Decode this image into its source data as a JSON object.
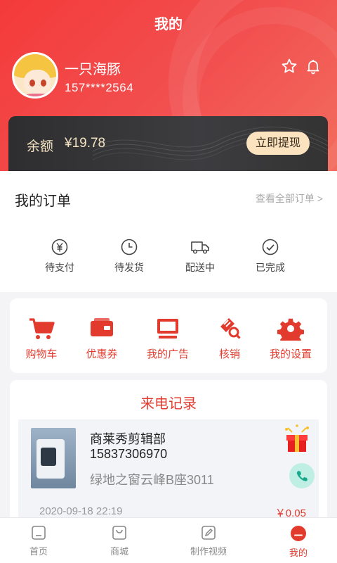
{
  "header": {
    "title": "我的"
  },
  "user": {
    "name": "一只海豚",
    "phone": "157****2564"
  },
  "actions": {
    "favorite_icon": "star-outline-icon",
    "notify_icon": "bell-icon"
  },
  "balance": {
    "label": "余额",
    "value": "¥19.78",
    "withdraw_label": "立即提现"
  },
  "orders": {
    "title": "我的订单",
    "view_all": "查看全部订单 >",
    "items": [
      {
        "label": "待支付",
        "icon": "yen-circle-icon"
      },
      {
        "label": "待发货",
        "icon": "clock-icon"
      },
      {
        "label": "配送中",
        "icon": "delivery-truck-icon"
      },
      {
        "label": "已完成",
        "icon": "check-circle-icon"
      }
    ]
  },
  "tools": [
    {
      "label": "购物车",
      "icon": "cart-icon"
    },
    {
      "label": "优惠券",
      "icon": "coupon-icon"
    },
    {
      "label": "我的广告",
      "icon": "monitor-icon"
    },
    {
      "label": "核销",
      "icon": "verify-ticket-icon"
    },
    {
      "label": "我的设置",
      "icon": "gear-icon"
    }
  ],
  "calls": {
    "title": "来电记录",
    "record": {
      "name": "商莱秀剪辑部",
      "phone": "15837306970",
      "address": "绿地之窗云峰B座3011",
      "date": "2020-09-18  22:19",
      "amount": "￥0.05"
    }
  },
  "tabbar": [
    {
      "label": "首页",
      "icon": "home-icon"
    },
    {
      "label": "商城",
      "icon": "shop-bag-icon"
    },
    {
      "label": "制作视频",
      "icon": "edit-video-icon"
    },
    {
      "label": "我的",
      "icon": "profile-icon",
      "active": true
    }
  ],
  "colors": {
    "accent": "#e23b2e",
    "header": "#f43a3a",
    "balance_bg": "#333336",
    "gold": "#f3e3c2"
  }
}
